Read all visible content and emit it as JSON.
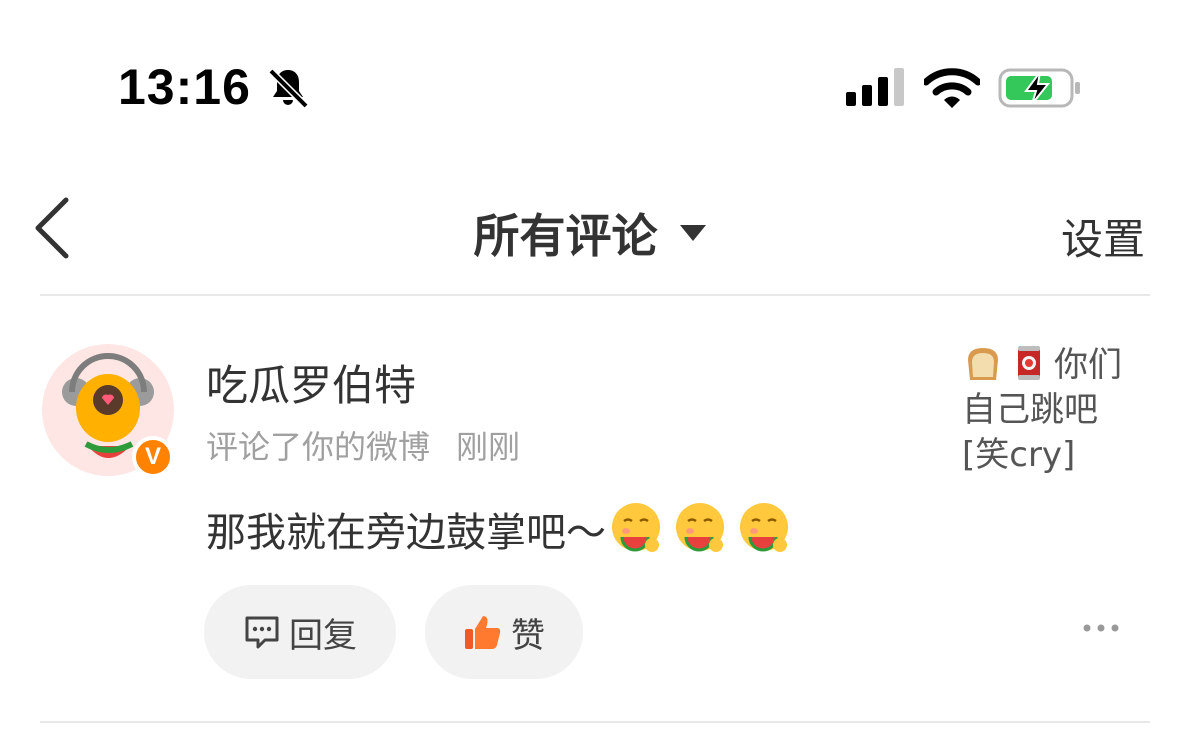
{
  "status_bar": {
    "time": "13:16",
    "icons": [
      "bell-muted-icon",
      "cellular-signal-icon",
      "wifi-icon",
      "battery-charging-icon"
    ],
    "battery_color": "#34c759"
  },
  "nav": {
    "back_icon": "chevron-left-icon",
    "title": "所有评论",
    "title_dropdown_icon": "caret-down-icon",
    "settings_label": "设置"
  },
  "comment": {
    "username": "吃瓜罗伯特",
    "action_text": "评论了你的微博",
    "time": "刚刚",
    "text": "那我就在旁边鼓掌吧～",
    "emoji": [
      "eating-watermelon-emoji",
      "eating-watermelon-emoji",
      "eating-watermelon-emoji"
    ],
    "verified_badge": "V",
    "quoted_post": {
      "emoji": [
        "bread-emoji",
        "can-emoji"
      ],
      "line1": "你们",
      "line2": "自己跳吧",
      "line3": "[笑cry]"
    },
    "reply_label": "回复",
    "like_label": "赞",
    "accent_color": "#ff8200"
  }
}
